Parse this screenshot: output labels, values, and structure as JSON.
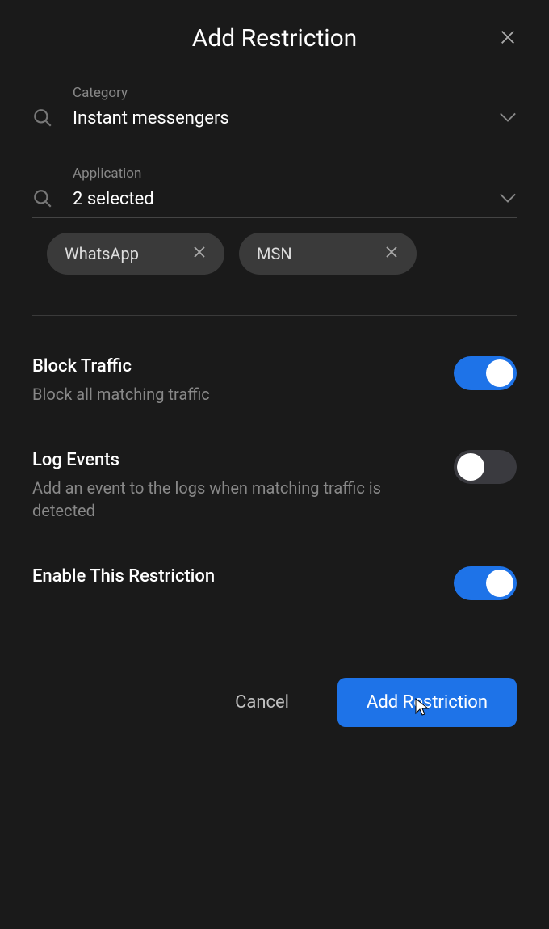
{
  "dialog": {
    "title": "Add Restriction"
  },
  "category": {
    "label": "Category",
    "value": "Instant messengers"
  },
  "application": {
    "label": "Application",
    "value": "2 selected",
    "chips": [
      {
        "label": "WhatsApp"
      },
      {
        "label": "MSN"
      }
    ]
  },
  "toggles": {
    "block_traffic": {
      "title": "Block Traffic",
      "desc": "Block all matching traffic",
      "on": true
    },
    "log_events": {
      "title": "Log Events",
      "desc": "Add an event to the logs when matching traffic is detected",
      "on": false
    },
    "enable_restriction": {
      "title": "Enable This Restriction",
      "on": true
    }
  },
  "footer": {
    "cancel": "Cancel",
    "submit": "Add Restriction"
  }
}
